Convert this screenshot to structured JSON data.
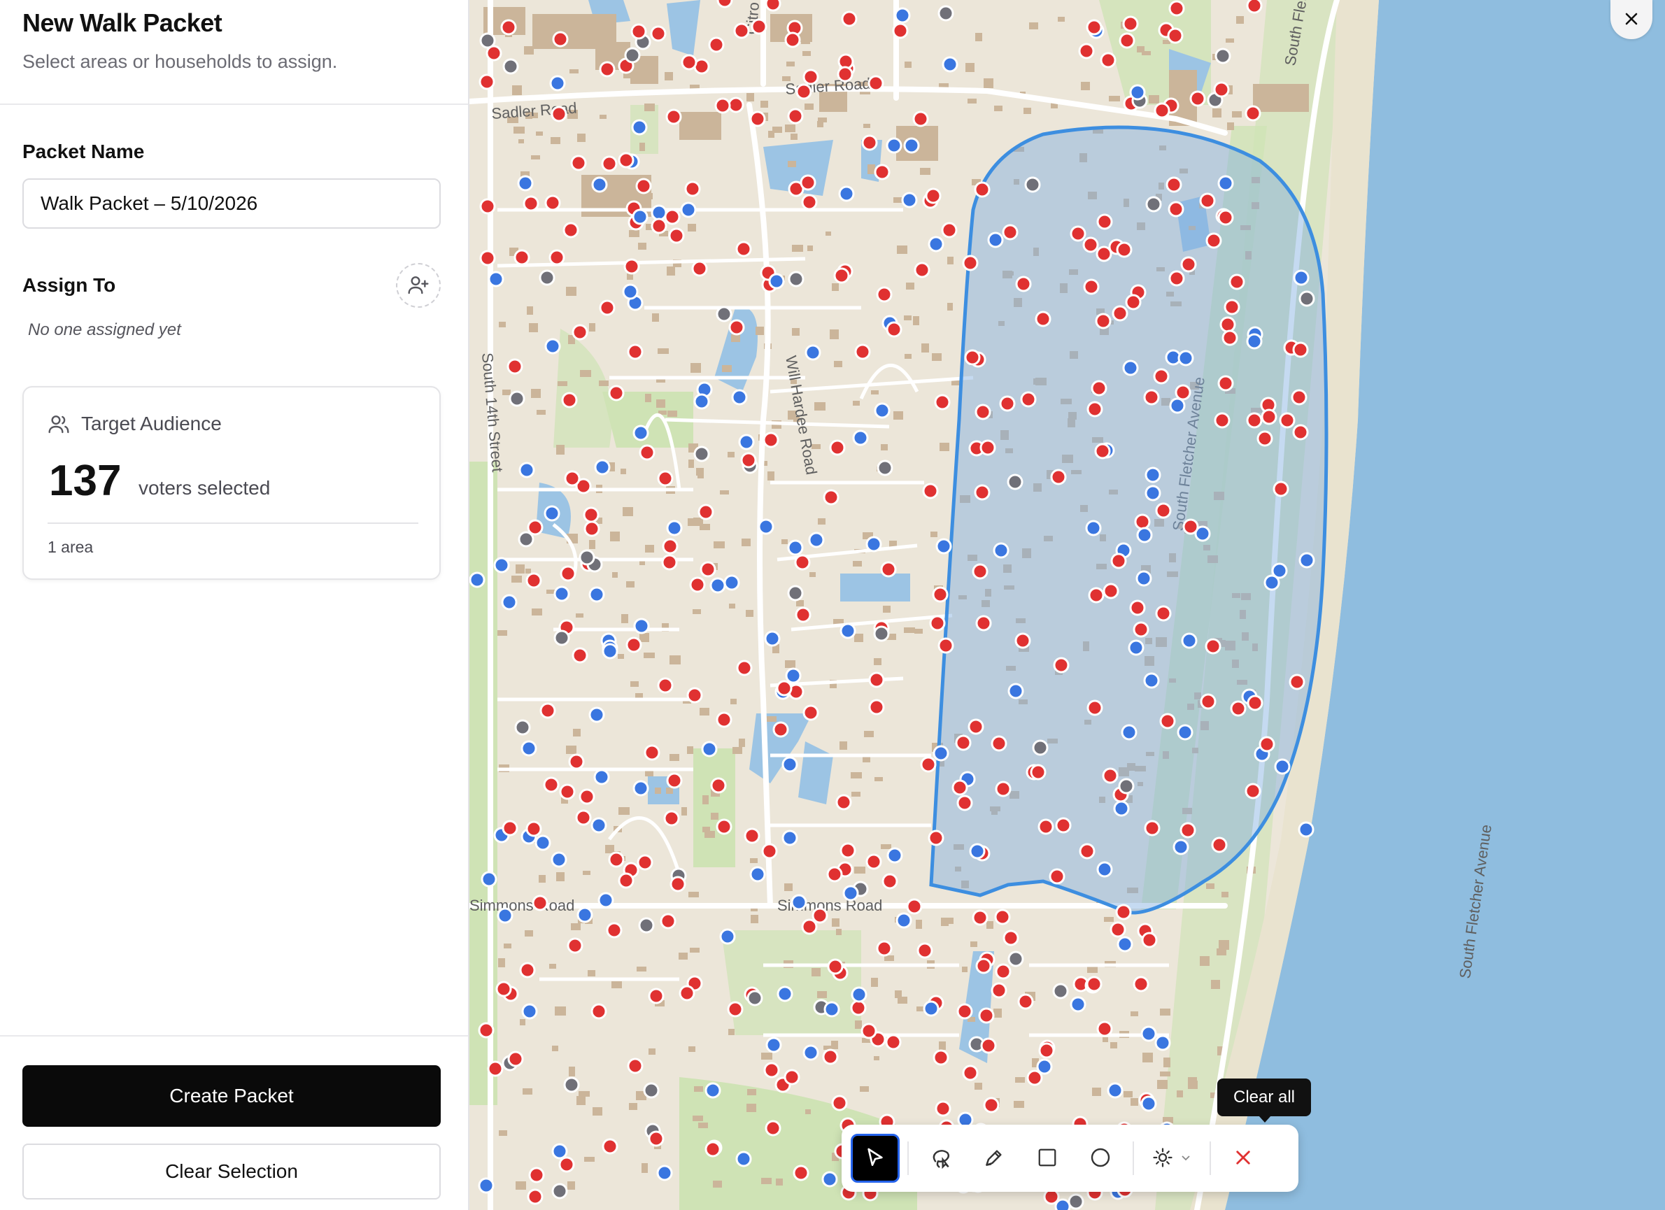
{
  "sidebar": {
    "title": "New Walk Packet",
    "subtitle": "Select areas or households to assign.",
    "packet_name_label": "Packet Name",
    "packet_name_value": "Walk Packet – 5/10/2026",
    "assign_label": "Assign To",
    "assign_empty": "No one assigned yet",
    "audience": {
      "title": "Target Audience",
      "count": "137",
      "count_label": "voters selected",
      "area_count": "1 area"
    },
    "create_button": "Create Packet",
    "clear_button": "Clear Selection"
  },
  "map": {
    "street_labels": [
      "Sadler Road",
      "Sadler Road",
      "South 14th Street",
      "Will Hardee Road",
      "Simmons Road",
      "Simmons Road",
      "South Fletcher Avenue",
      "South Fletcher Avenue",
      "South Fletcher Avenue",
      "Citro"
    ],
    "tooltip": "Clear all",
    "colors": {
      "land": "#ece6d9",
      "park": "#cfe3b5",
      "water": "#9cc4e4",
      "ocean": "#8fbddf",
      "building": "#cbb59a",
      "selection_fill": "#7eaee0",
      "selection_stroke": "#3d8ee0",
      "marker_red": "#e03131",
      "marker_blue": "#3a76e0",
      "marker_gray": "#707078"
    },
    "tools": [
      "select-pointer",
      "lasso",
      "pen-draw",
      "rectangle",
      "circle",
      "settings",
      "clear-all"
    ]
  }
}
